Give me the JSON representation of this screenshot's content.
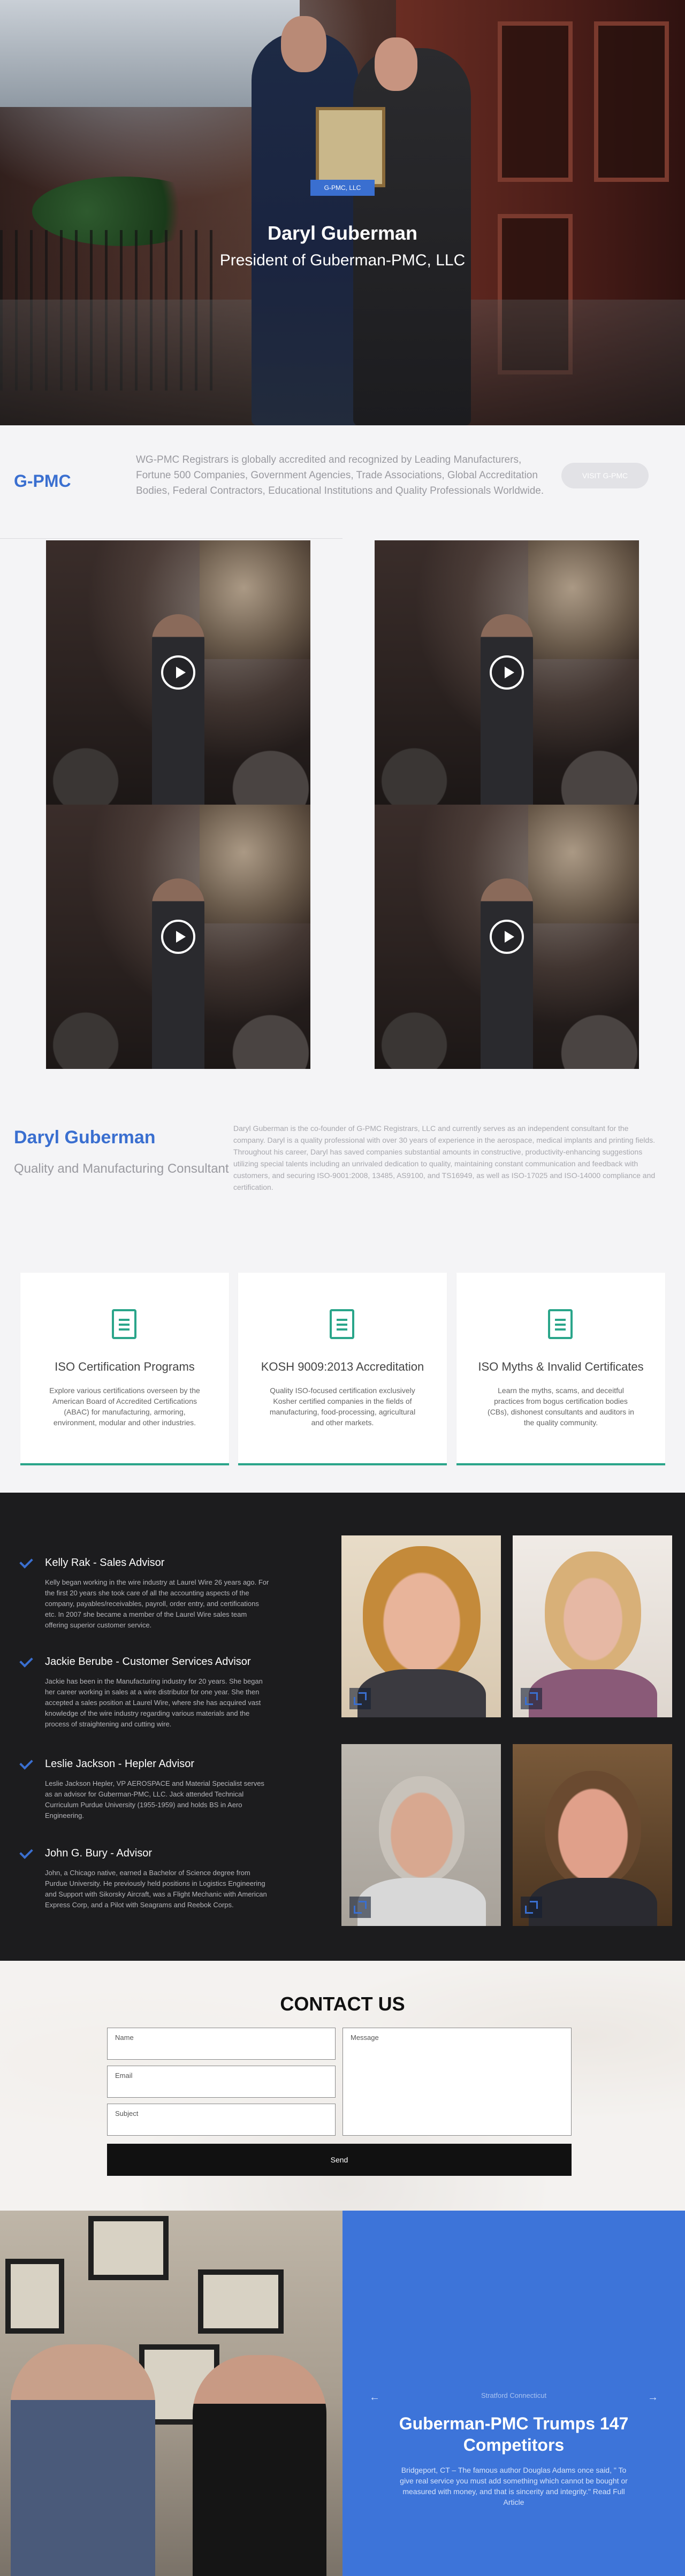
{
  "hero": {
    "tag": "G-PMC, LLC",
    "name": "Daryl Guberman",
    "subtitle": "President of Guberman-PMC, LLC"
  },
  "intro": {
    "logo": "G-PMC",
    "text": "WG-PMC Registrars is globally accredited and recognized by Leading Manufacturers, Fortune 500 Companies, Government Agencies, Trade Associations, Global Accreditation Bodies, Federal Contractors, Educational Institutions and Quality Professionals Worldwide.",
    "button_label": "VISIT G-PMC"
  },
  "videos": [
    {
      "label": "video-1"
    },
    {
      "label": "video-2"
    },
    {
      "label": "video-3"
    },
    {
      "label": "video-4"
    }
  ],
  "about": {
    "name": "Daryl Guberman",
    "subtitle": "Quality and Manufacturing Consultant",
    "text": "Daryl Guberman is the co-founder of G-PMC Registrars, LLC and currently serves as an independent consultant for the company. Daryl is a quality professional with over 30 years of experience in the aerospace, medical implants and printing fields. Throughout his career, Daryl has saved companies substantial amounts in constructive, productivity-enhancing suggestions utilizing special talents including an unrivaled dedication to quality, maintaining constant communication and feedback with customers, and securing ISO-9001:2008, 13485, AS9100, and TS16949, as well as ISO-17025 and ISO-14000 compliance and certification."
  },
  "cards": [
    {
      "title": "ISO Certification Programs",
      "text": "Explore various certifications overseen by the American Board of Accredited Certifications (ABAC) for manufacturing, armoring, environment, modular and other industries."
    },
    {
      "title": "KOSH 9009:2013 Accreditation",
      "text": "Quality ISO-focused certification exclusively Kosher certified companies in the fields of manufacturing, food-processing, agricultural and other markets."
    },
    {
      "title": "ISO Myths & Invalid Certificates",
      "text": "Learn the myths, scams, and deceitful practices from bogus certification bodies (CBs), dishonest consultants and auditors in the quality community."
    }
  ],
  "team": [
    {
      "name": "Kelly Rak - Sales Advisor",
      "bio": "Kelly began working in the wire industry at Laurel Wire 26 years ago. For the first 20 years she took care of all the accounting aspects of the company, payables/receivables, payroll, order entry, and certifications etc. In 2007 she became a member of the Laurel Wire sales team offering superior customer service."
    },
    {
      "name": "Jackie Berube - Customer Services Advisor",
      "bio": "Jackie has been in the Manufacturing industry for 20 years. She began her career working in sales at a wire distributor for one year. She then accepted a sales position at Laurel Wire, where she has acquired vast knowledge of the wire industry regarding various materials and the process of straightening and cutting wire."
    },
    {
      "name": "Leslie Jackson - Hepler Advisor",
      "bio": "Leslie Jackson Hepler, VP AEROSPACE and Material Specialist serves as an advisor for Guberman-PMC, LLC. Jack attended Technical Curriculum Purdue University (1955-1959) and holds BS in Aero Engineering."
    },
    {
      "name": "John G. Bury - Advisor",
      "bio": "John, a Chicago native, earned a Bachelor of Science degree from Purdue University. He previously held positions in Logistics Engineering and Support with Sikorsky Aircraft, was a Flight Mechanic with American Express Corp, and a Pilot with Seagrams and Reebok Corps."
    }
  ],
  "contact": {
    "title": "CONTACT US",
    "name_placeholder": "Name",
    "email_placeholder": "Email",
    "subject_placeholder": "Subject",
    "message_placeholder": "Message",
    "send_label": "Send"
  },
  "news": {
    "prev_arrow": "←",
    "next_arrow": "→",
    "location": "Stratford Connecticut",
    "title": "Guberman-PMC Trumps 147 Competitors",
    "body": "Bridgeport, CT – The famous author Douglas Adams once said, \" To give real service you must add something which cannot be bought or measured with money, and that is sincerity and integrity.\" Read Full Article"
  },
  "colors": {
    "accent": "#3a6fd0",
    "card_accent": "#2aa58a",
    "dark_bg": "#1c1c1e",
    "news_bg": "#3d74d9"
  }
}
